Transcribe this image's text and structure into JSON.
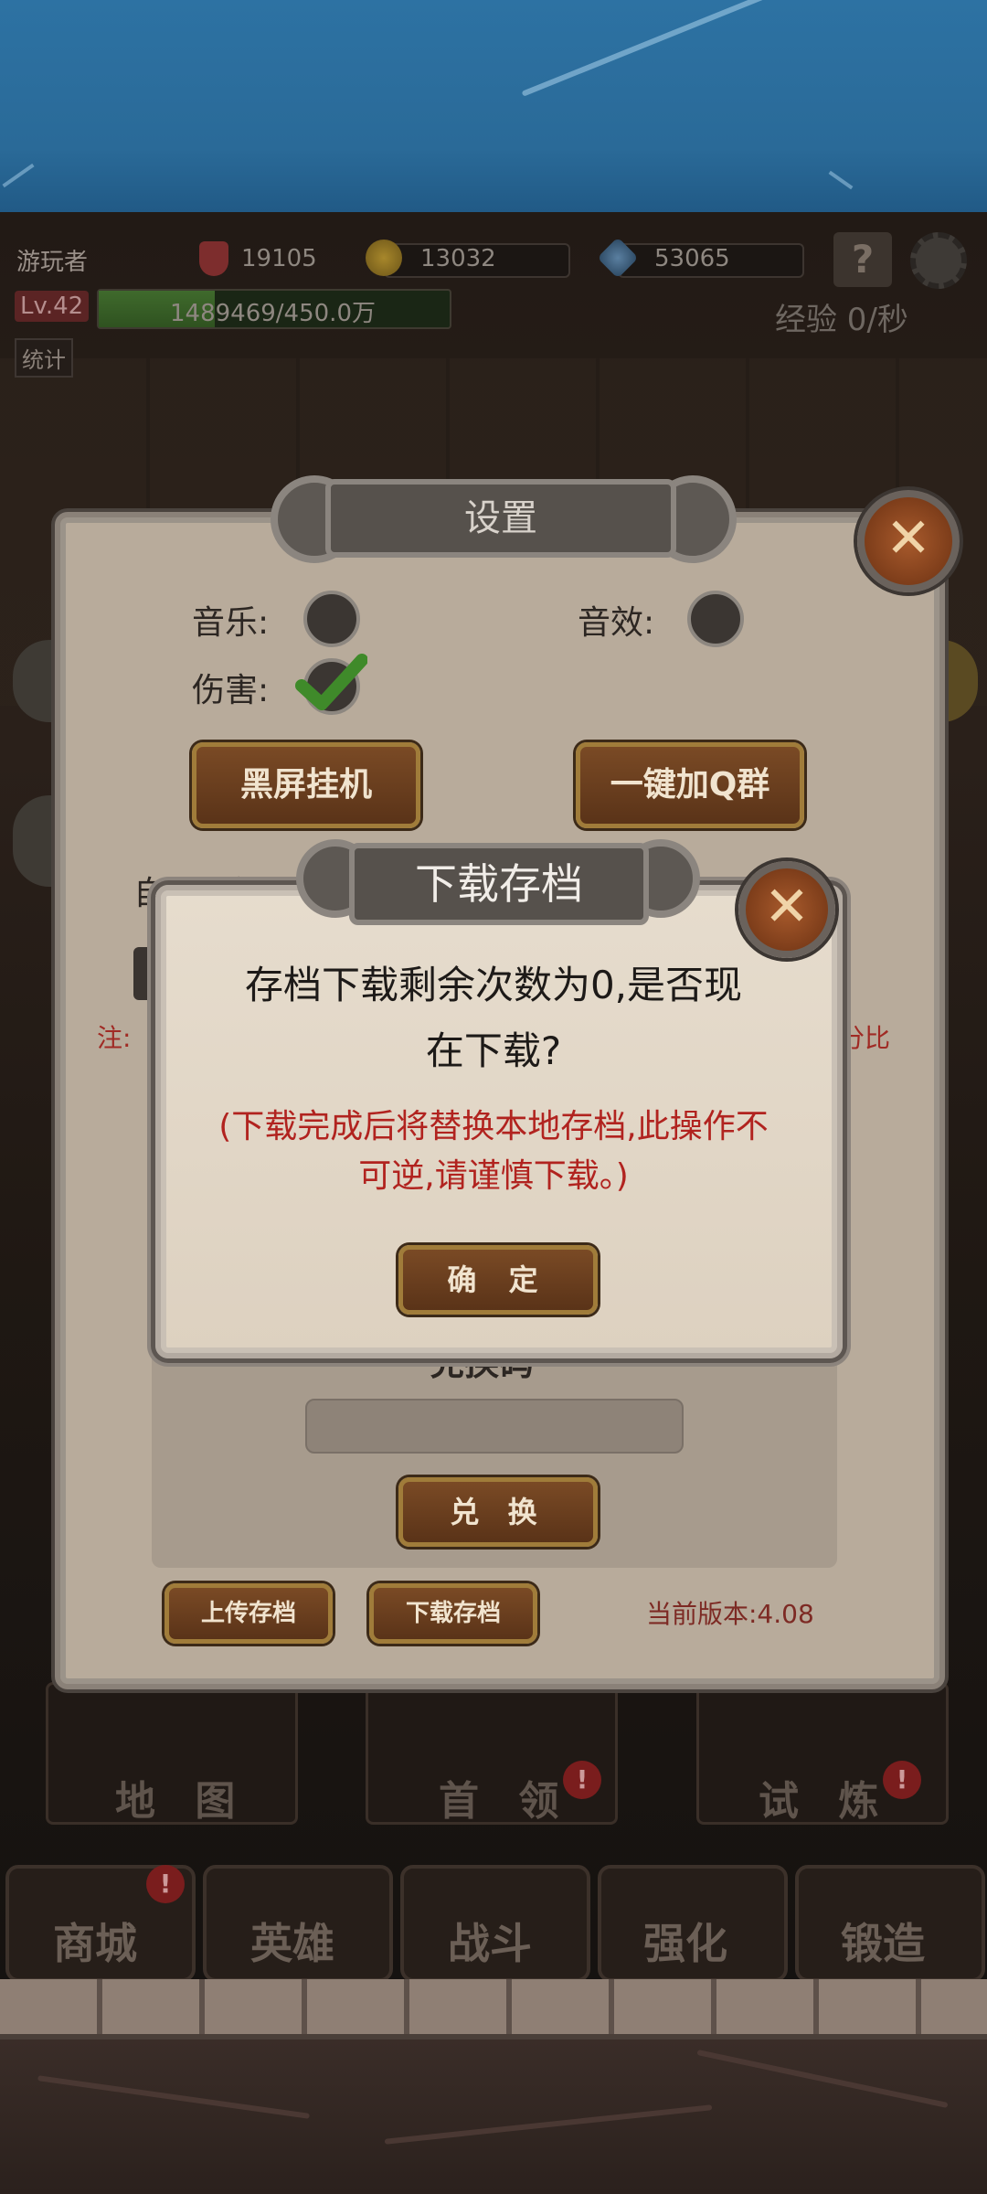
{
  "hud": {
    "player_name": "游玩者",
    "power": "19105",
    "gold": "13032",
    "diamond": "53065",
    "level": "Lv.42",
    "exp": "1489469/450.0万",
    "exp_rate": "经验 0/秒",
    "stats_button": "统计",
    "exp_progress": 0.33
  },
  "settings": {
    "title": "设置",
    "music_label": "音乐:",
    "sound_label": "音效:",
    "damage_label": "伤害:",
    "black_screen_button": "黑屏挂机",
    "join_qq_button": "一键加Q群",
    "note_prefix": "注:",
    "note_suffix": "分比",
    "auto_label_partial": "自动分解",
    "redeem_label_partial": "兑换码",
    "redeem_button": "兑 换",
    "upload_button": "上传存档",
    "download_button": "下载存档",
    "version": "当前版本:4.08",
    "music_on": false,
    "sound_on": false,
    "damage_on": true
  },
  "download_dialog": {
    "title": "下载存档",
    "message_line1": "存档下载剩余次数为0,是否现",
    "message_line2": "在下载?",
    "warning_line1": "(下载完成后将替换本地存档,此操作不",
    "warning_line2": "可逆,请谨慎下载。)",
    "confirm_button": "确 定"
  },
  "tiles": [
    "地 图",
    "首 领",
    "试 炼"
  ],
  "nav": [
    {
      "label": "商城",
      "badge": true
    },
    {
      "label": "英雄",
      "badge": false
    },
    {
      "label": "战斗",
      "badge": false
    },
    {
      "label": "强化",
      "badge": false
    },
    {
      "label": "锻造",
      "badge": false
    }
  ],
  "icons": [
    "close-icon",
    "checkmark-icon",
    "gold-coin-icon",
    "diamond-icon",
    "help-book-icon",
    "gear-icon",
    "shield-icon"
  ],
  "colors": {
    "warning_text": "#b1231f",
    "panel": "#b8ab9b",
    "dialog": "#e2d7c7",
    "wood_button": "#6a3d1e"
  }
}
